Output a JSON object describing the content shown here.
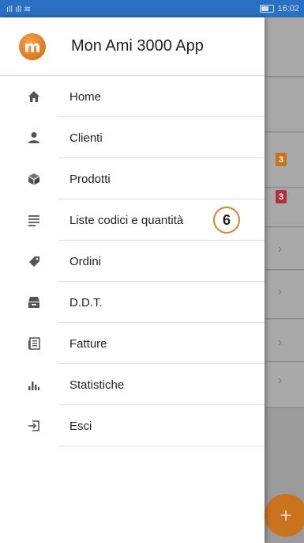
{
  "status_bar": {
    "signal": "ıll ıll ≋",
    "time": "16:02"
  },
  "app": {
    "title": "Mon Ami 3000 App",
    "logo_letter": "m"
  },
  "menu": [
    {
      "label": "Home",
      "icon": "home-icon"
    },
    {
      "label": "Clienti",
      "icon": "person-icon"
    },
    {
      "label": "Prodotti",
      "icon": "box-icon"
    },
    {
      "label": "Liste codici e quantità",
      "icon": "list-icon"
    },
    {
      "label": "Ordini",
      "icon": "tag-icon"
    },
    {
      "label": "D.D.T.",
      "icon": "inbox-tray-icon"
    },
    {
      "label": "Fatture",
      "icon": "newspaper-icon"
    },
    {
      "label": "Statistiche",
      "icon": "bar-chart-icon"
    },
    {
      "label": "Esci",
      "icon": "exit-icon"
    }
  ],
  "step_badge": "6",
  "background": {
    "badges": [
      "3",
      "3"
    ],
    "badge_colors": [
      "#c9731f",
      "#b3303a"
    ],
    "fab_symbol": "+"
  }
}
